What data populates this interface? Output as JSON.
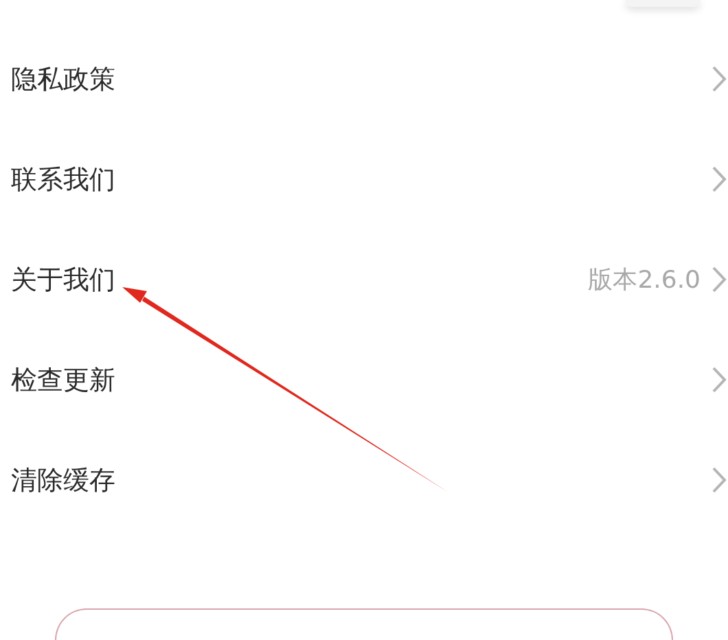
{
  "settings_items": [
    {
      "label": "隐私政策"
    },
    {
      "label": "联系我们"
    },
    {
      "label": "关于我们",
      "value": "版本2.6.0"
    },
    {
      "label": "检查更新"
    },
    {
      "label": "清除缓存"
    }
  ],
  "annotation": {
    "kind": "arrow"
  },
  "bottom_button": {
    "kind": "outline"
  }
}
